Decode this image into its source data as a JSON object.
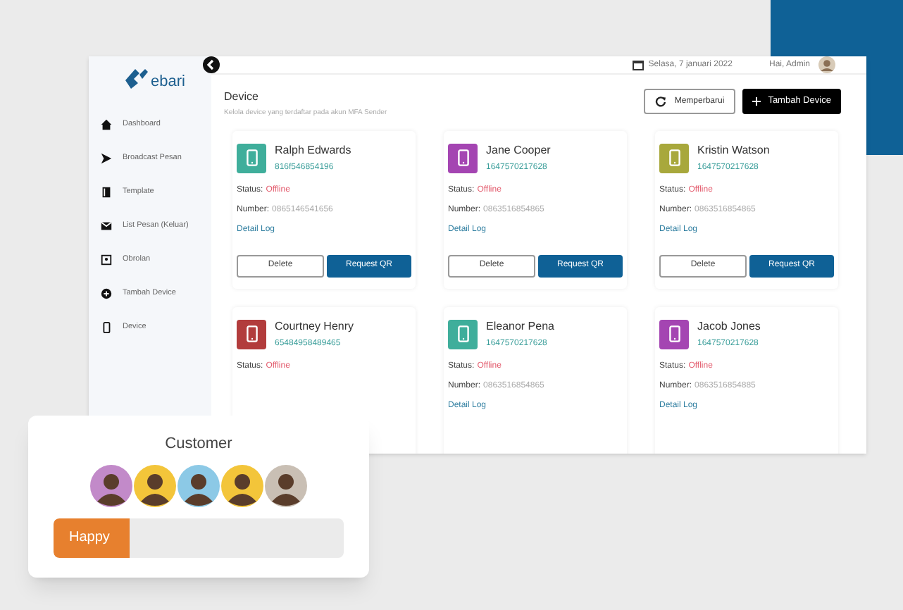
{
  "logo": {
    "text": "ebari"
  },
  "header": {
    "date": "Selasa, 7 januari 2022",
    "greeting": "Hai, Admin"
  },
  "sidebar": {
    "items": [
      {
        "label": "Dashboard"
      },
      {
        "label": "Broadcast Pesan"
      },
      {
        "label": "Template"
      },
      {
        "label": "List Pesan (Keluar)"
      },
      {
        "label": "Obrolan"
      },
      {
        "label": "Tambah Device"
      },
      {
        "label": "Device"
      }
    ]
  },
  "page": {
    "title": "Device",
    "subtitle": "Kelola device yang terdaftar pada akun MFA Sender",
    "buttons": [
      {
        "label": "Memperbarui",
        "kind": "outline"
      },
      {
        "label": "Tambah Device",
        "kind": "dark"
      }
    ]
  },
  "devices": [
    {
      "name": "Ralph Edwards",
      "id": "816f546854196",
      "color": "#3fae9b",
      "status_label": "Status:",
      "status": "Offline",
      "number_label": "Number:",
      "number": "0865146541656",
      "detail": "Detail Log",
      "buttons": [
        "Delete",
        "Request QR"
      ]
    },
    {
      "name": "Jane Cooper",
      "id": "1647570217628",
      "color": "#a445b2",
      "status_label": "Status:",
      "status": "Offline",
      "number_label": "Number:",
      "number": "0863516854865",
      "detail": "Detail Log",
      "buttons": [
        "Delete",
        "Request QR"
      ]
    },
    {
      "name": "Kristin Watson",
      "id": "1647570217628",
      "color": "#a8a83c",
      "status_label": "Status:",
      "status": "Offline",
      "number_label": "Number:",
      "number": "0863516854865",
      "detail": "Detail Log",
      "buttons": [
        "Delete",
        "Request QR"
      ]
    },
    {
      "name": "Courtney Henry",
      "id": "65484958489465",
      "color": "#b23c3c",
      "status_label": "Status:",
      "status": "Offline"
    },
    {
      "name": "Eleanor Pena",
      "id": "1647570217628",
      "color": "#3fae9b",
      "status_label": "Status:",
      "status": "Offline",
      "number_label": "Number:",
      "number": "0863516854865",
      "detail": "Detail Log"
    },
    {
      "name": "Jacob Jones",
      "id": "1647570217628",
      "color": "#a445b2",
      "status_label": "Status:",
      "status": "Offline",
      "number_label": "Number:",
      "number": "0863516854885",
      "detail": "Detail Log"
    }
  ],
  "customer_card": {
    "title": "Customer",
    "avatars": [
      {
        "color": "#c28ac9"
      },
      {
        "color": "#f3c53a"
      },
      {
        "color": "#8cc9e6"
      },
      {
        "color": "#f3c53a"
      },
      {
        "color": "#c9bfb4"
      }
    ],
    "mood": {
      "label": "Happy",
      "level": 0.26
    }
  }
}
